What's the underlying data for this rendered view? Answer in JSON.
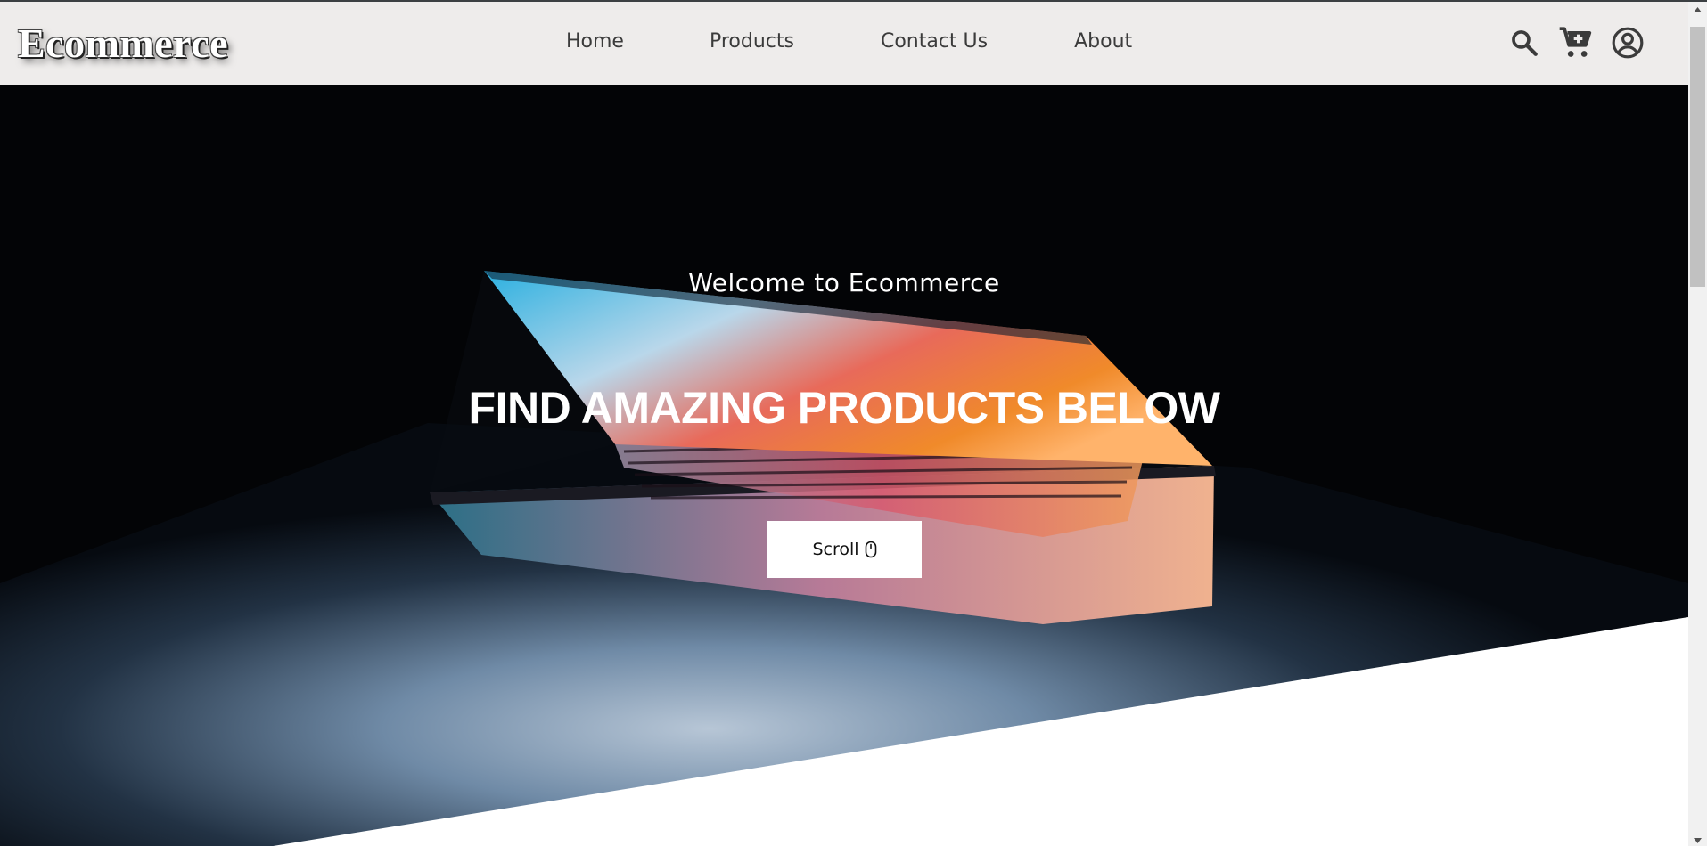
{
  "brand": {
    "logo_text": "Ecommerce"
  },
  "nav": {
    "links": [
      {
        "label": "Home"
      },
      {
        "label": "Products"
      },
      {
        "label": "Contact Us"
      },
      {
        "label": "About"
      }
    ],
    "icons": [
      "search-icon",
      "cart-add-icon",
      "account-circle-icon"
    ]
  },
  "hero": {
    "subtitle": "Welcome to Ecommerce",
    "title": "FIND AMAZING PRODUCTS BELOW",
    "scroll_label": "Scroll",
    "scroll_icon": "mouse-icon"
  },
  "colors": {
    "navbar_bg": "#eeeceb",
    "nav_text": "#3b3b3b",
    "hero_bg": "#000000",
    "button_bg": "#ffffff"
  }
}
